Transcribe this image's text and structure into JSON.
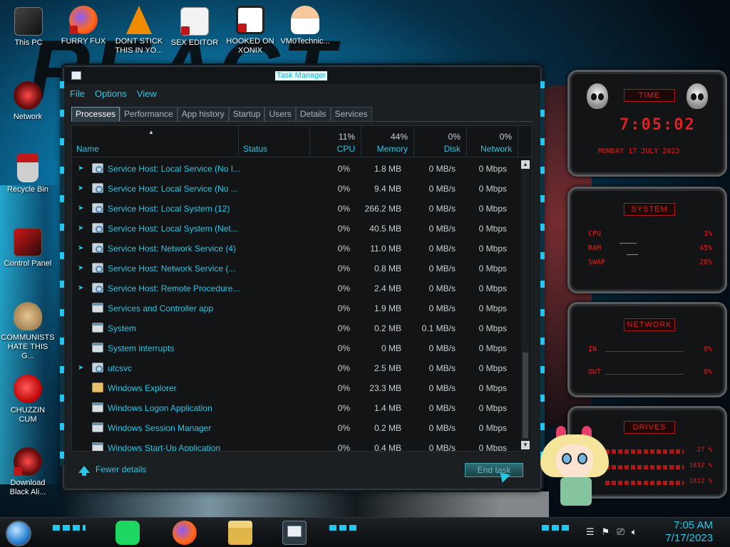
{
  "desktop": {
    "icons": [
      {
        "label": "This PC"
      },
      {
        "label": "FURRY FUX"
      },
      {
        "label": "DONT STICK THIS IN YO..."
      },
      {
        "label": "SEX EDITOR"
      },
      {
        "label": "HOOKED ON XONIX"
      },
      {
        "label": "VM0Technic..."
      },
      {
        "label": "Network"
      },
      {
        "label": "Recycle Bin"
      },
      {
        "label": "Control Panel"
      },
      {
        "label": "COMMUNISTS HATE THIS G..."
      },
      {
        "label": "CHUZZIN CUM"
      },
      {
        "label": "Download Black Ali..."
      }
    ]
  },
  "task_manager": {
    "title": "Task Manager",
    "menu": [
      "File",
      "Options",
      "View"
    ],
    "tabs": [
      "Processes",
      "Performance",
      "App history",
      "Startup",
      "Users",
      "Details",
      "Services"
    ],
    "active_tab": "Processes",
    "columns": {
      "name": "Name",
      "status": "Status",
      "cpu": {
        "label": "CPU",
        "pct": "11%"
      },
      "memory": {
        "label": "Memory",
        "pct": "44%"
      },
      "disk": {
        "label": "Disk",
        "pct": "0%"
      },
      "network": {
        "label": "Network",
        "pct": "0%"
      }
    },
    "rows": [
      {
        "name": "Service Host: Local Service (No I...",
        "icon": "svc",
        "expandable": true,
        "cpu": "0%",
        "memory": "1.8 MB",
        "disk": "0 MB/s",
        "network": "0 Mbps"
      },
      {
        "name": "Service Host: Local Service (No ...",
        "icon": "svc",
        "expandable": true,
        "cpu": "0%",
        "memory": "9.4 MB",
        "disk": "0 MB/s",
        "network": "0 Mbps"
      },
      {
        "name": "Service Host: Local System (12)",
        "icon": "svc",
        "expandable": true,
        "cpu": "0%",
        "memory": "266.2 MB",
        "disk": "0 MB/s",
        "network": "0 Mbps"
      },
      {
        "name": "Service Host: Local System (Net...",
        "icon": "svc",
        "expandable": true,
        "cpu": "0%",
        "memory": "40.5 MB",
        "disk": "0 MB/s",
        "network": "0 Mbps"
      },
      {
        "name": "Service Host: Network Service (4)",
        "icon": "svc",
        "expandable": true,
        "cpu": "0%",
        "memory": "11.0 MB",
        "disk": "0 MB/s",
        "network": "0 Mbps"
      },
      {
        "name": "Service Host: Network Service (...",
        "icon": "svc",
        "expandable": true,
        "cpu": "0%",
        "memory": "0.8 MB",
        "disk": "0 MB/s",
        "network": "0 Mbps"
      },
      {
        "name": "Service Host: Remote Procedure...",
        "icon": "svc",
        "expandable": true,
        "cpu": "0%",
        "memory": "2.4 MB",
        "disk": "0 MB/s",
        "network": "0 Mbps"
      },
      {
        "name": "Services and Controller app",
        "icon": "win",
        "expandable": false,
        "cpu": "0%",
        "memory": "1.9 MB",
        "disk": "0 MB/s",
        "network": "0 Mbps"
      },
      {
        "name": "System",
        "icon": "win",
        "expandable": false,
        "cpu": "0%",
        "memory": "0.2 MB",
        "disk": "0.1 MB/s",
        "network": "0 Mbps"
      },
      {
        "name": "System interrupts",
        "icon": "win",
        "expandable": false,
        "cpu": "0%",
        "memory": "0 MB",
        "disk": "0 MB/s",
        "network": "0 Mbps"
      },
      {
        "name": "utcsvc",
        "icon": "svc",
        "expandable": true,
        "cpu": "0%",
        "memory": "2.5 MB",
        "disk": "0 MB/s",
        "network": "0 Mbps"
      },
      {
        "name": "Windows Explorer",
        "icon": "folder",
        "expandable": false,
        "cpu": "0%",
        "memory": "23.3 MB",
        "disk": "0 MB/s",
        "network": "0 Mbps"
      },
      {
        "name": "Windows Logon Application",
        "icon": "win",
        "expandable": false,
        "cpu": "0%",
        "memory": "1.4 MB",
        "disk": "0 MB/s",
        "network": "0 Mbps"
      },
      {
        "name": "Windows Session Manager",
        "icon": "win",
        "expandable": false,
        "cpu": "0%",
        "memory": "0.2 MB",
        "disk": "0 MB/s",
        "network": "0 Mbps"
      },
      {
        "name": "Windows Start-Up Application",
        "icon": "win",
        "expandable": false,
        "cpu": "0%",
        "memory": "0.4 MB",
        "disk": "0 MB/s",
        "network": "0 Mbps"
      }
    ],
    "fewer_details": "Fewer details",
    "end_task": "End task"
  },
  "widgets": {
    "time": {
      "title": "TIME",
      "clock": "7:05:02",
      "date": "MONDAY 17 JULY 2023"
    },
    "system": {
      "title": "SYSTEM",
      "cpu_label": "CPU",
      "cpu": "1%",
      "ram_label": "RAM",
      "ram": "45%",
      "swap_label": "SWAP",
      "swap": "28%"
    },
    "network": {
      "title": "NETWORK",
      "in_label": "IN",
      "in": "0%",
      "out_label": "OUT",
      "out": "0%"
    },
    "drives": {
      "title": "DRIVES",
      "d1": "27 %",
      "d2": "1812 %",
      "d3": "1812 %"
    }
  },
  "taskbar": {
    "clock_time": "7:05 AM",
    "clock_date": "7/17/2023"
  },
  "colors": {
    "accent": "#27c7e8",
    "widget_red": "#e02020"
  }
}
